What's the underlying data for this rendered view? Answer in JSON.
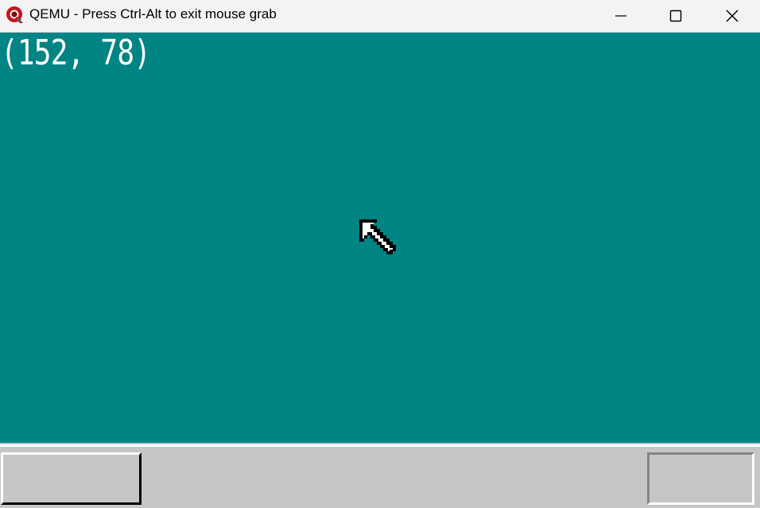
{
  "window": {
    "title": "QEMU - Press Ctrl-Alt to exit mouse grab",
    "app_icon": "qemu-logo-icon",
    "controls": {
      "minimize_icon": "minimize-icon",
      "maximize_icon": "maximize-icon",
      "close_icon": "close-icon"
    }
  },
  "desktop": {
    "background_color": "#008484",
    "mouse_position_text": "(152, 78)",
    "cursor_icon": "arrow-cursor-icon"
  },
  "taskbar": {
    "background_color": "#c6c6c6",
    "start_button_label": "",
    "tray_label": ""
  }
}
